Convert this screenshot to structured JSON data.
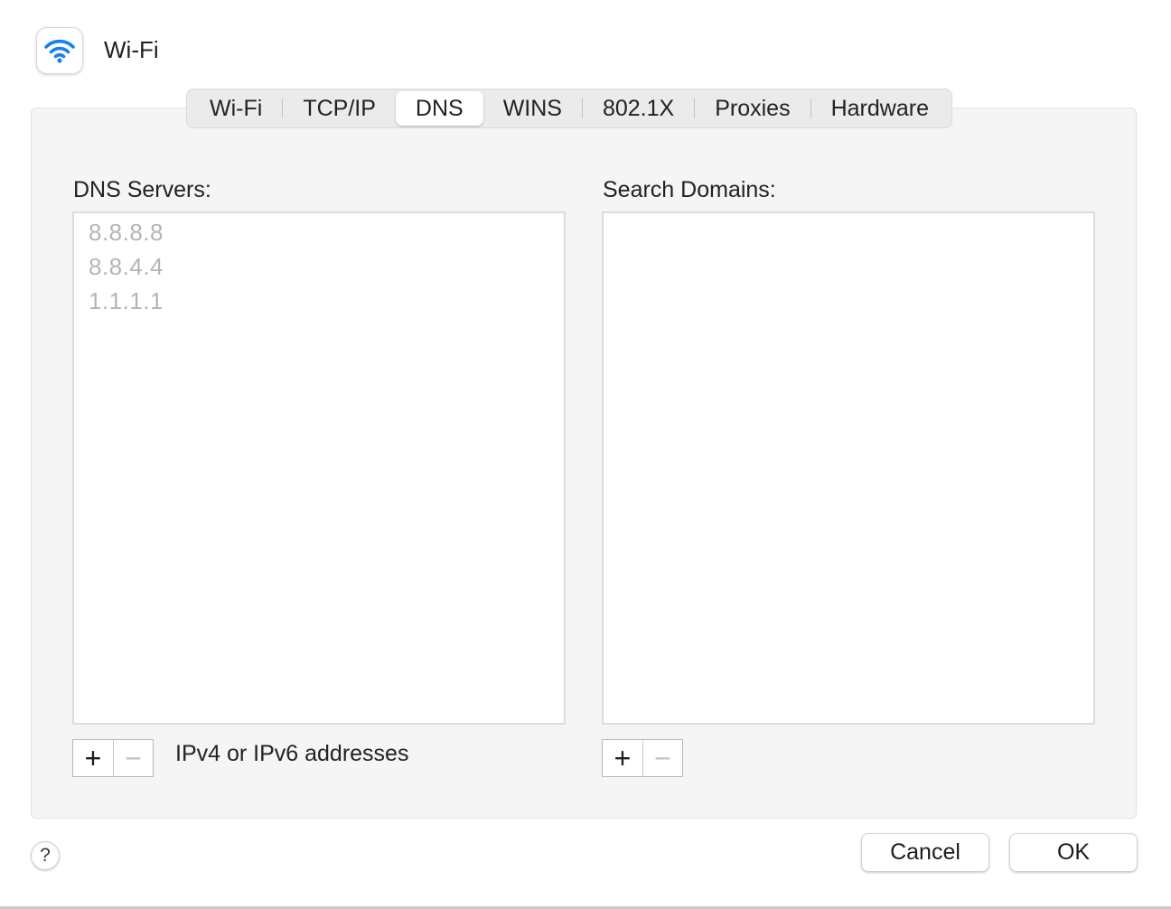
{
  "header": {
    "title": "Wi-Fi",
    "icon": "wifi-icon",
    "icon_color": "#1a7ff0"
  },
  "tabs": [
    {
      "label": "Wi-Fi",
      "active": false
    },
    {
      "label": "TCP/IP",
      "active": false
    },
    {
      "label": "DNS",
      "active": true
    },
    {
      "label": "WINS",
      "active": false
    },
    {
      "label": "802.1X",
      "active": false
    },
    {
      "label": "Proxies",
      "active": false
    },
    {
      "label": "Hardware",
      "active": false
    }
  ],
  "dns_servers": {
    "label": "DNS Servers:",
    "items": [
      "8.8.8.8",
      "8.8.4.4",
      "1.1.1.1"
    ],
    "add_label": "+",
    "remove_label": "−",
    "hint": "IPv4 or IPv6 addresses"
  },
  "search_domains": {
    "label": "Search Domains:",
    "items": [],
    "add_label": "+",
    "remove_label": "−"
  },
  "footer": {
    "help_label": "?",
    "cancel_label": "Cancel",
    "ok_label": "OK"
  }
}
